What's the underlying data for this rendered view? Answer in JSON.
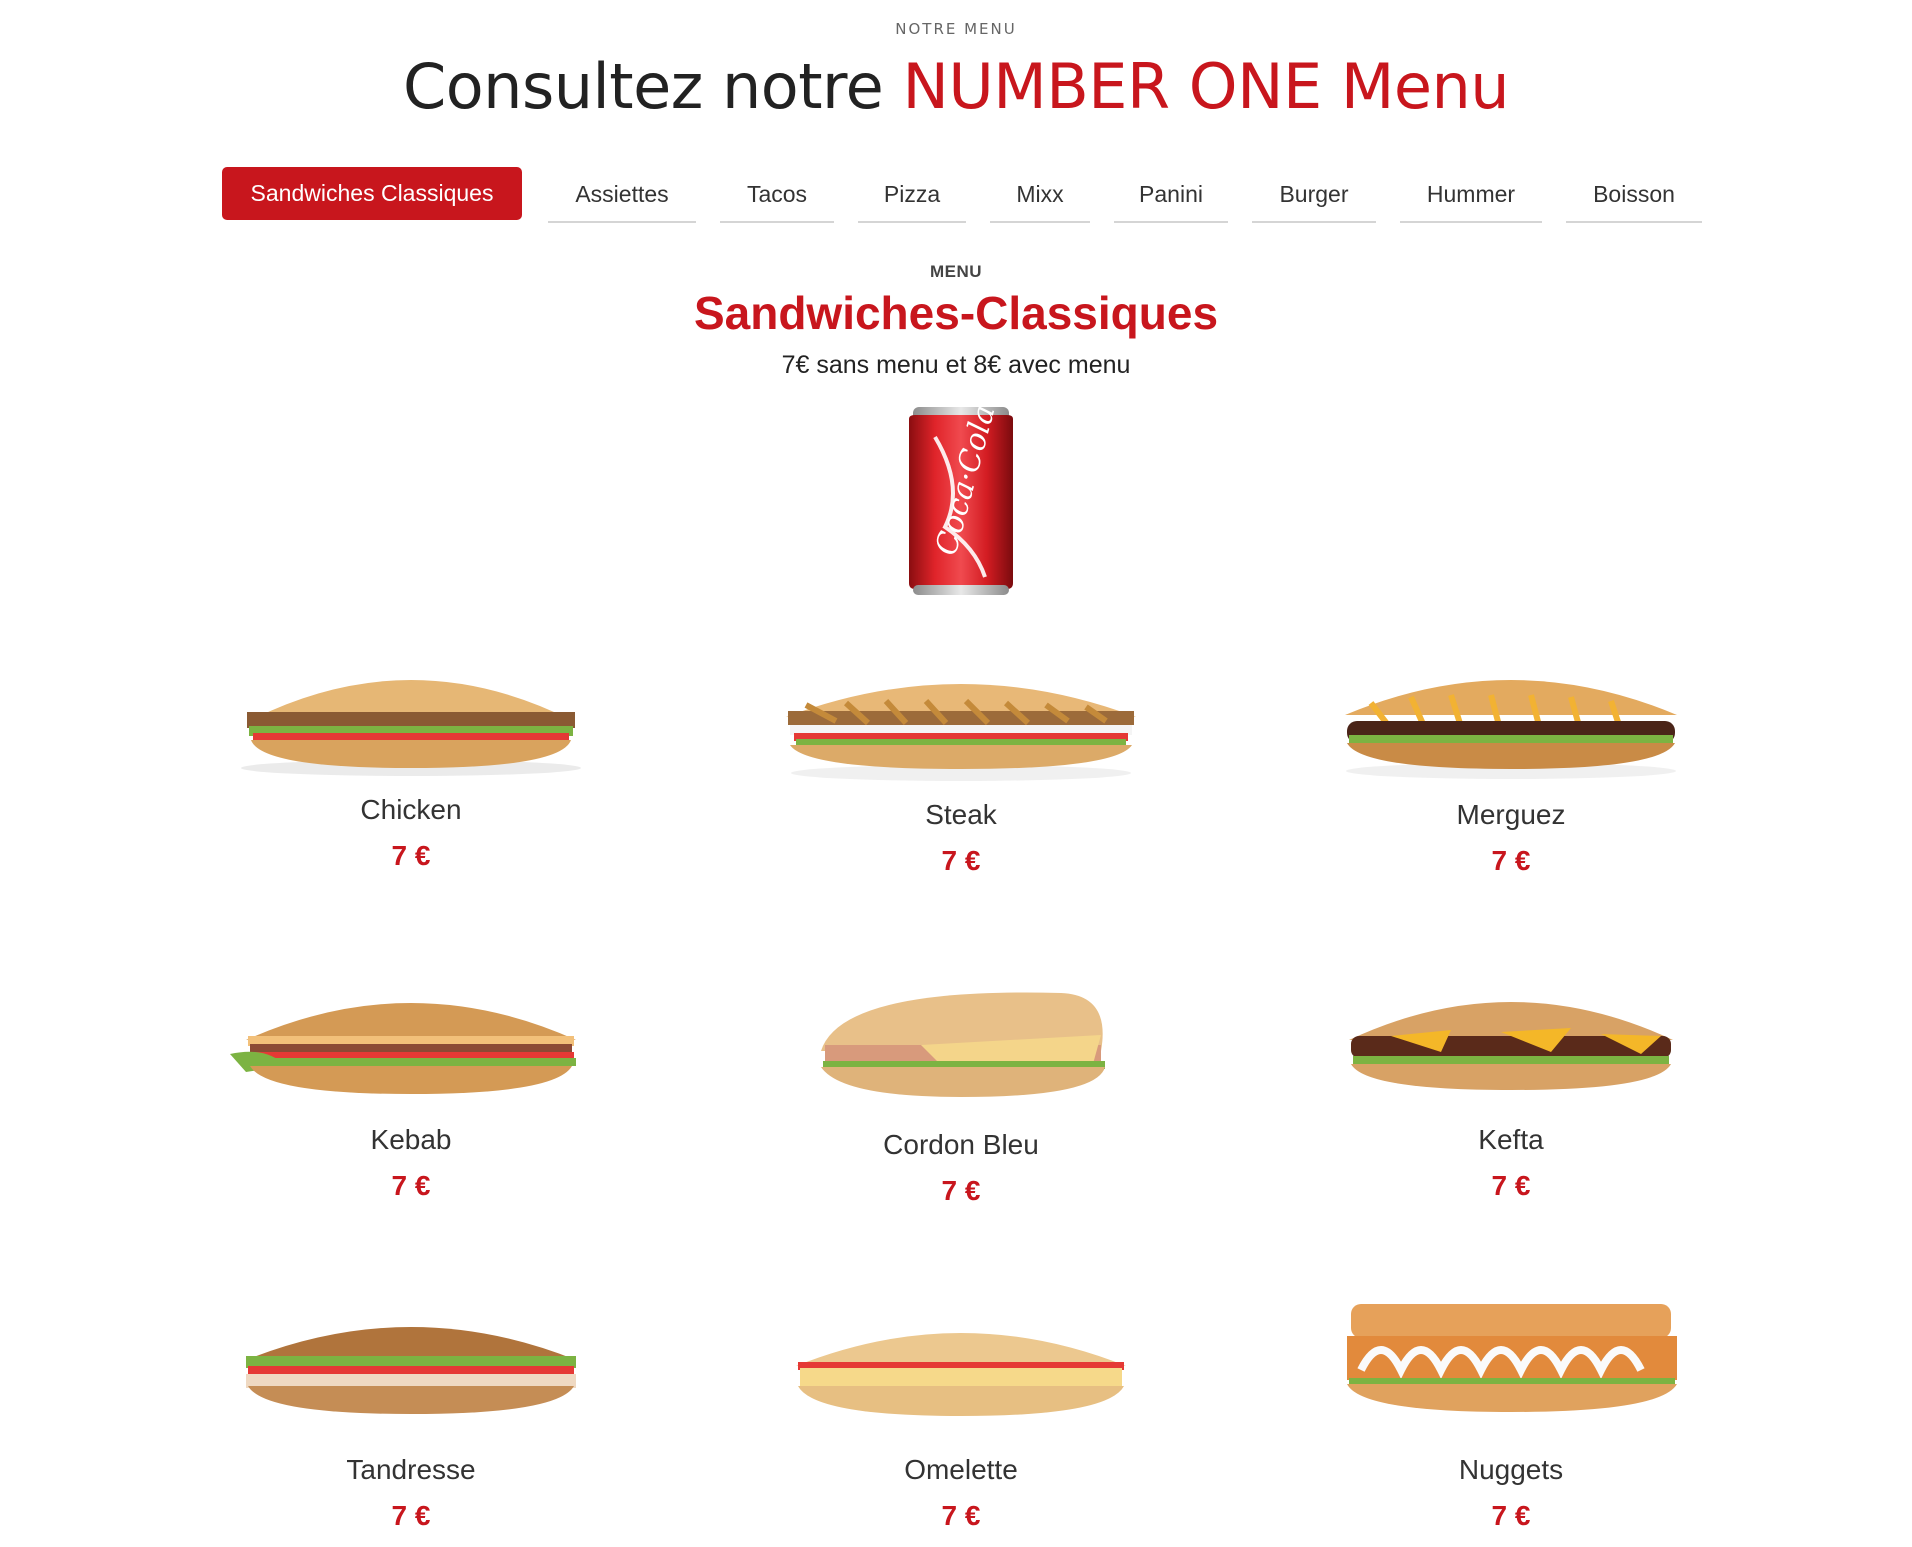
{
  "header": {
    "eyebrow": "NOTRE MENU",
    "title_prefix": "Consultez notre ",
    "title_accent": "NUMBER ONE Menu"
  },
  "tabs": [
    {
      "label": "Sandwiches Classiques",
      "active": true
    },
    {
      "label": "Assiettes",
      "active": false
    },
    {
      "label": "Tacos",
      "active": false
    },
    {
      "label": "Pizza",
      "active": false
    },
    {
      "label": "Mixx",
      "active": false
    },
    {
      "label": "Panini",
      "active": false
    },
    {
      "label": "Burger",
      "active": false
    },
    {
      "label": "Hummer",
      "active": false
    },
    {
      "label": "Boisson",
      "active": false
    }
  ],
  "section": {
    "eyebrow": "MENU",
    "title": "Sandwiches-Classiques",
    "subtitle": "7€ sans menu et 8€ avec menu"
  },
  "drink_image": "cola-can",
  "items": [
    {
      "name": "Chicken",
      "price": "7 €",
      "image": "chicken-sandwich"
    },
    {
      "name": "Steak",
      "price": "7 €",
      "image": "steak-sandwich"
    },
    {
      "name": "Merguez",
      "price": "7 €",
      "image": "merguez-sandwich"
    },
    {
      "name": "Kebab",
      "price": "7 €",
      "image": "kebab-sandwich"
    },
    {
      "name": "Cordon Bleu",
      "price": "7 €",
      "image": "cordon-bleu-sandwich"
    },
    {
      "name": "Kefta",
      "price": "7 €",
      "image": "kefta-sandwich"
    },
    {
      "name": "Tandresse",
      "price": "7 €",
      "image": "tandresse-sandwich"
    },
    {
      "name": "Omelette",
      "price": "7 €",
      "image": "omelette-sandwich"
    },
    {
      "name": "Nuggets",
      "price": "7 €",
      "image": "nuggets-sandwich"
    }
  ],
  "colors": {
    "accent": "#c8161d",
    "text": "#222222",
    "tab_underline": "#d5d5d5"
  }
}
